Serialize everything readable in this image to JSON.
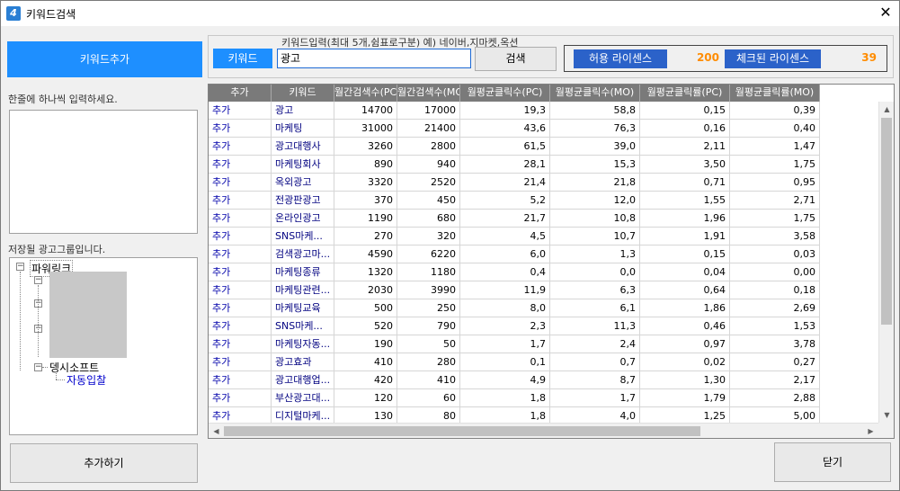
{
  "window": {
    "title": "키워드검색",
    "close_glyph": "✕"
  },
  "left": {
    "add_keyword_button": "키워드추가",
    "hint": "한줄에 하나씩 입력하세요.",
    "group_label": "저장될 광고그룹입니다.",
    "tree": {
      "root": "파워링크",
      "child": "뎅시소프트",
      "leaf": "자동입찰"
    },
    "add_button": "추가하기"
  },
  "search": {
    "caption": "키워드입력(최대 5개,쉼표로구분) 예) 네이버,지마켓,옥션",
    "tag": "키워드",
    "value": "광고",
    "button": "검색"
  },
  "license": {
    "allow_label": "허용 라이센스",
    "allow_value": "200",
    "checked_label": "체크된 라이센스",
    "checked_value": "39"
  },
  "grid": {
    "columns": [
      "추가",
      "키워드",
      "월간검색수(PC)",
      "월간검색수(MO)",
      "월평균클릭수(PC)",
      "월평균클릭수(MO)",
      "월평균클릭률(PC)",
      "월평균클릭률(MO)"
    ],
    "rows": [
      [
        "추가",
        "광고",
        "14700",
        "17000",
        "19,3",
        "58,8",
        "0,15",
        "0,39"
      ],
      [
        "추가",
        "마케팅",
        "31000",
        "21400",
        "43,6",
        "76,3",
        "0,16",
        "0,40"
      ],
      [
        "추가",
        "광고대행사",
        "3260",
        "2800",
        "61,5",
        "39,0",
        "2,11",
        "1,47"
      ],
      [
        "추가",
        "마케팅회사",
        "890",
        "940",
        "28,1",
        "15,3",
        "3,50",
        "1,75"
      ],
      [
        "추가",
        "옥외광고",
        "3320",
        "2520",
        "21,4",
        "21,8",
        "0,71",
        "0,95"
      ],
      [
        "추가",
        "전광판광고",
        "370",
        "450",
        "5,2",
        "12,0",
        "1,55",
        "2,71"
      ],
      [
        "추가",
        "온라인광고",
        "1190",
        "680",
        "21,7",
        "10,8",
        "1,96",
        "1,75"
      ],
      [
        "추가",
        "SNS마케...",
        "270",
        "320",
        "4,5",
        "10,7",
        "1,91",
        "3,58"
      ],
      [
        "추가",
        "검색광고마...",
        "4590",
        "6220",
        "6,0",
        "1,3",
        "0,15",
        "0,03"
      ],
      [
        "추가",
        "마케팅종류",
        "1320",
        "1180",
        "0,4",
        "0,0",
        "0,04",
        "0,00"
      ],
      [
        "추가",
        "마케팅관련...",
        "2030",
        "3990",
        "11,9",
        "6,3",
        "0,64",
        "0,18"
      ],
      [
        "추가",
        "마케팅교육",
        "500",
        "250",
        "8,0",
        "6,1",
        "1,86",
        "2,69"
      ],
      [
        "추가",
        "SNS마케...",
        "520",
        "790",
        "2,3",
        "11,3",
        "0,46",
        "1,53"
      ],
      [
        "추가",
        "마케팅자동...",
        "190",
        "50",
        "1,7",
        "2,4",
        "0,97",
        "3,78"
      ],
      [
        "추가",
        "광고효과",
        "410",
        "280",
        "0,1",
        "0,7",
        "0,02",
        "0,27"
      ],
      [
        "추가",
        "광고대행업...",
        "420",
        "410",
        "4,9",
        "8,7",
        "1,30",
        "2,17"
      ],
      [
        "추가",
        "부산광고대...",
        "120",
        "60",
        "1,8",
        "1,7",
        "1,79",
        "2,88"
      ],
      [
        "추가",
        "디지털마케...",
        "130",
        "80",
        "1,8",
        "4,0",
        "1,25",
        "5,00"
      ]
    ]
  },
  "close_button": "닫기"
}
